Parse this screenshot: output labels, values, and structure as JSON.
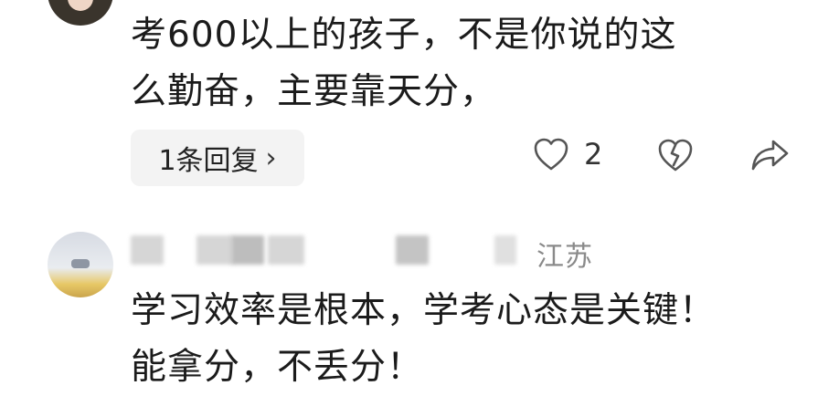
{
  "comment1": {
    "text_lines": [
      "考600以上的孩子，不是你说的这",
      "么勤奋，主要靠天分，"
    ],
    "reply_button": "1条回复",
    "reply_chevron": "›",
    "like_count": "2",
    "icons": [
      "heart-icon",
      "broken-heart-icon",
      "share-icon"
    ]
  },
  "comment2": {
    "location": "江苏",
    "text_lines": [
      "学习效率是根本，学考心态是关键！",
      "能拿分，不丢分！"
    ]
  },
  "colors": {
    "text": "#1b1b1b",
    "meta": "#8a8a8a",
    "pill_bg": "#f3f3f3",
    "icon": "#555555"
  }
}
